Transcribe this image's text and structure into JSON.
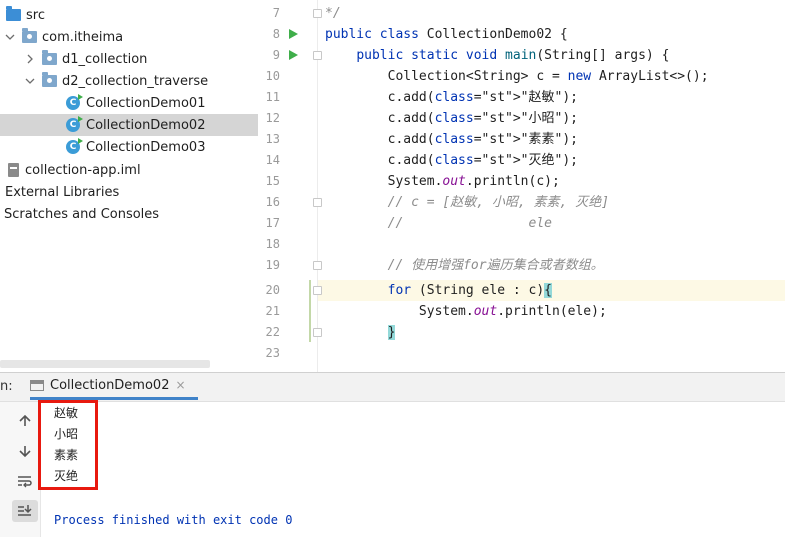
{
  "project_tree": {
    "items": [
      {
        "label": "src",
        "type": "src-folder",
        "indent": 0,
        "chevron": ""
      },
      {
        "label": "com.itheima",
        "type": "package",
        "indent": 0,
        "chevron": "down"
      },
      {
        "label": "d1_collection",
        "type": "package",
        "indent": 1,
        "chevron": "right"
      },
      {
        "label": "d2_collection_traverse",
        "type": "package",
        "indent": 1,
        "chevron": "down"
      },
      {
        "label": "CollectionDemo01",
        "type": "class",
        "indent": 2,
        "chevron": ""
      },
      {
        "label": "CollectionDemo02",
        "type": "class",
        "indent": 2,
        "chevron": "",
        "selected": true
      },
      {
        "label": "CollectionDemo03",
        "type": "class",
        "indent": 2,
        "chevron": ""
      },
      {
        "label": "collection-app.iml",
        "type": "file",
        "indent": -1,
        "chevron": ""
      },
      {
        "label": "External Libraries",
        "type": "text",
        "indent": -2,
        "chevron": ""
      },
      {
        "label": "Scratches and Consoles",
        "type": "text",
        "indent": -2,
        "chevron": ""
      }
    ]
  },
  "editor": {
    "lines": [
      {
        "n": "7",
        "text": "*/"
      },
      {
        "n": "8",
        "text": "public class CollectionDemo02 {"
      },
      {
        "n": "9",
        "text": "    public static void main(String[] args) {"
      },
      {
        "n": "10",
        "text": "        Collection<String> c = new ArrayList<>();"
      },
      {
        "n": "11",
        "text": "        c.add(\"赵敏\");"
      },
      {
        "n": "12",
        "text": "        c.add(\"小昭\");"
      },
      {
        "n": "13",
        "text": "        c.add(\"素素\");"
      },
      {
        "n": "14",
        "text": "        c.add(\"灭绝\");"
      },
      {
        "n": "15",
        "text": "        System.out.println(c);"
      },
      {
        "n": "16",
        "text": "        // c = [赵敏, 小昭, 素素, 灭绝]"
      },
      {
        "n": "17",
        "text": "        //                ele"
      },
      {
        "n": "18",
        "text": ""
      },
      {
        "n": "19",
        "text": "        // 使用增强for遍历集合或者数组。"
      },
      {
        "n": "20",
        "text": "        for (String ele : c){"
      },
      {
        "n": "21",
        "text": "            System.out.println(ele);"
      },
      {
        "n": "22",
        "text": "        }"
      },
      {
        "n": "23",
        "text": ""
      }
    ]
  },
  "run_window": {
    "label": "n:",
    "tab_label": "CollectionDemo02",
    "tab_close": "×",
    "output_lines": [
      "赵敏",
      "小昭",
      "素素",
      "灭绝"
    ],
    "process_message": "Process finished with exit code 0"
  },
  "colors": {
    "keyword": "#0033b3",
    "string": "#067d17",
    "comment": "#8c8c8c",
    "run_arrow": "#3fae4a",
    "highlight_box": "#e8190f",
    "selection": "#d5d5d5"
  },
  "icons": {
    "src_folder": "folder-icon",
    "package": "package-icon",
    "class": "java-class-icon",
    "file": "iml-file-icon",
    "run": "run-arrow-icon",
    "console": "console-icon"
  }
}
